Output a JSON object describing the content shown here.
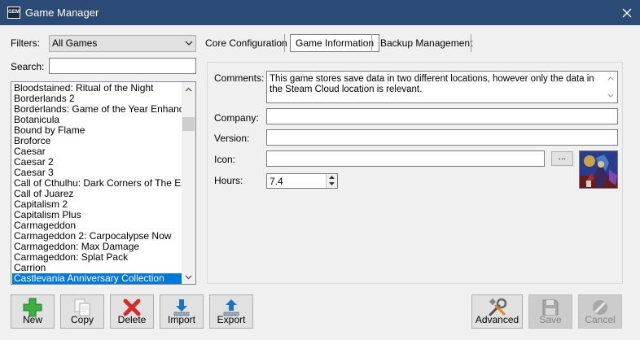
{
  "window": {
    "title": "Game Manager",
    "icon_text": "GEM"
  },
  "filters": {
    "label": "Filters:",
    "selected": "All Games"
  },
  "search": {
    "label": "Search:",
    "value": ""
  },
  "games": [
    "Bloodstained: Ritual of the Night",
    "Borderlands 2",
    "Borderlands: Game of the Year Enhanced",
    "Botanicula",
    "Bound by Flame",
    "Broforce",
    "Caesar",
    "Caesar 2",
    "Caesar 3",
    "Call of Cthulhu: Dark Corners of The Earth",
    "Call of Juarez",
    "Capitalism 2",
    "Capitalism Plus",
    "Carmageddon",
    "Carmageddon 2: Carpocalypse Now",
    "Carmageddon: Max Damage",
    "Carmageddon: Splat Pack",
    "Carrion",
    "Castlevania Anniversary Collection"
  ],
  "selected_game": "Castlevania Anniversary Collection",
  "tabs": [
    {
      "label": "Core Configuration",
      "active": false
    },
    {
      "label": "Game Information",
      "active": true
    },
    {
      "label": "Backup Management",
      "active": false
    }
  ],
  "info": {
    "comments_label": "Comments:",
    "comments": "This game stores save data in two different locations, however only the data in the Steam Cloud location is relevant.",
    "company_label": "Company:",
    "company": "",
    "version_label": "Version:",
    "version": "",
    "icon_label": "Icon:",
    "icon_path": "",
    "browse_label": "...",
    "hours_label": "Hours:",
    "hours": "7.4"
  },
  "buttons": {
    "new": "New",
    "copy": "Copy",
    "delete": "Delete",
    "import": "Import",
    "export": "Export",
    "advanced": "Advanced",
    "save": "Save",
    "cancel": "Cancel"
  },
  "colors": {
    "titlebar": "#2b4a76",
    "selection": "#0078d7",
    "new_icon": "#3cb043",
    "delete_icon": "#d42a2a",
    "import_export_icon": "#1e73be"
  },
  "icons": [
    "app-icon",
    "close-icon",
    "chevron-down-icon",
    "scroll-up-icon",
    "scroll-down-icon",
    "plus-icon",
    "copy-icon",
    "delete-x-icon",
    "import-icon",
    "export-icon",
    "tools-icon",
    "floppy-disk-icon",
    "cancel-icon"
  ]
}
